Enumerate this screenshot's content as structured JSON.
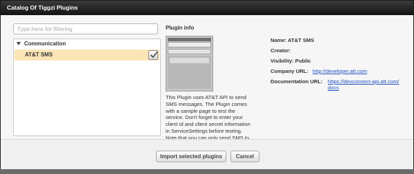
{
  "dialog": {
    "title": "Catalog Of Tiggzi Plugins"
  },
  "filter": {
    "placeholder": "Type here for filtering",
    "value": ""
  },
  "tree": {
    "groups": [
      {
        "label": "Communication",
        "expanded": true,
        "items": [
          {
            "label": "AT&T SMS",
            "selected": true,
            "checked": true
          }
        ]
      }
    ]
  },
  "plugin_info": {
    "section_title": "Plugin info",
    "thumbnail_icon": "plugin-screenshot-thumbnail",
    "description": "This Plugin uses AT&T API to send\nSMS messages.  The Plugin comes\nwith a sample page to test the\nservice. Don't forget to enter your\nclient id and client secret information\nin ServiceSettings before testing.\nNote that you can only send SMS to\nAT&T numbers.",
    "name_label": "Name:",
    "name_value": "AT&T SMS",
    "creator_label": "Creator:",
    "creator_value": "",
    "visibility_label": "Visibility:",
    "visibility_value": "Public",
    "company_url_label": "Company URL:",
    "company_url_value": "http://developer.att.com",
    "documentation_url_label": "Documentation URL:",
    "documentation_url_line1": "https://devconnect-api.att.com/",
    "documentation_url_line2": "docs"
  },
  "footer": {
    "import_label": "Import selected plugins",
    "cancel_label": "Cancel"
  },
  "colors": {
    "titlebar": "#1e1e1e",
    "selected_row": "#fbe5b6",
    "link": "#1f4fbf"
  }
}
